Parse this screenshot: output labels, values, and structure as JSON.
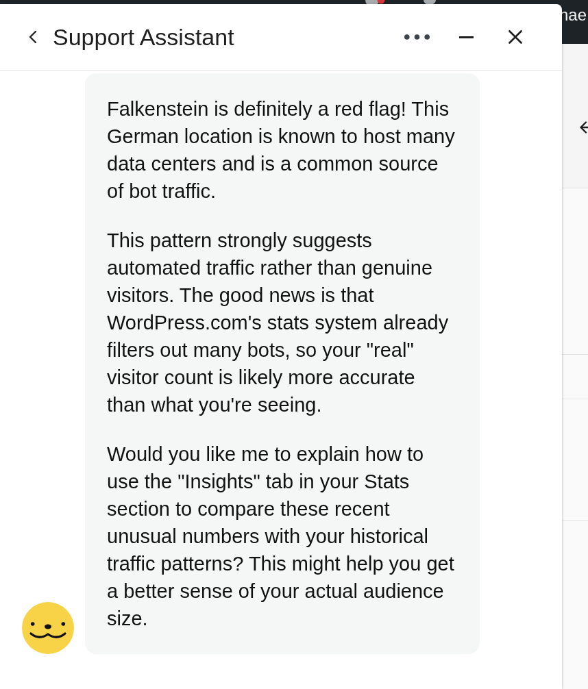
{
  "background_app": {
    "account_name": "nae"
  },
  "chat_window": {
    "title": "Support Assistant"
  },
  "messages": [
    {
      "kind": "assistant",
      "paragraphs": [
        "Falkenstein is definitely a red flag! This German location is known to host many data centers and is a common source of bot traffic.",
        "This pattern strongly suggests automated traffic rather than genuine visitors. The good news is that WordPress.com's stats system already filters out many bots, so your \"real\" visitor count is likely more accurate than what you're seeing.",
        "Would you like me to explain how to use the \"Insights\" tab in your Stats section to compare these recent unusual numbers with your historical traffic patterns? This might help you get a better sense of your actual audience size."
      ]
    }
  ]
}
